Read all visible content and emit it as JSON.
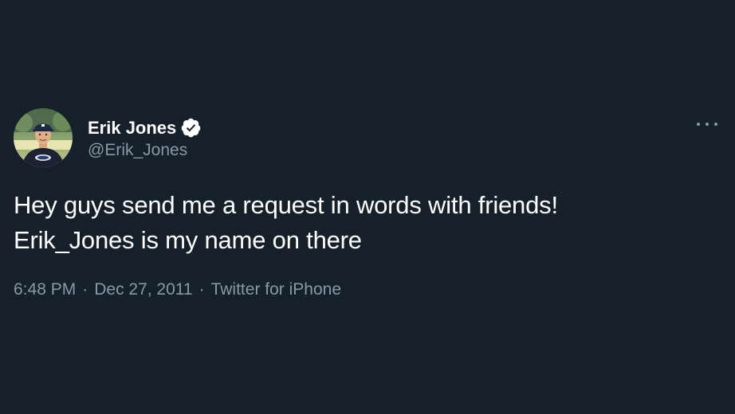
{
  "tweet": {
    "author": {
      "display_name": "Erik Jones",
      "handle": "@Erik_Jones",
      "verified": true,
      "avatar_icon": "profile-photo"
    },
    "text_lines": [
      "Hey guys send me a request in words with friends!",
      "Erik_Jones is my name on there"
    ],
    "meta": {
      "time": "6:48 PM",
      "separator": "·",
      "date": "Dec 27, 2011",
      "source": "Twitter for iPhone"
    },
    "more_icon": "more-dots-icon"
  },
  "colors": {
    "background": "#15202b",
    "primary_text": "#ffffff",
    "secondary_text": "#8899a6"
  }
}
